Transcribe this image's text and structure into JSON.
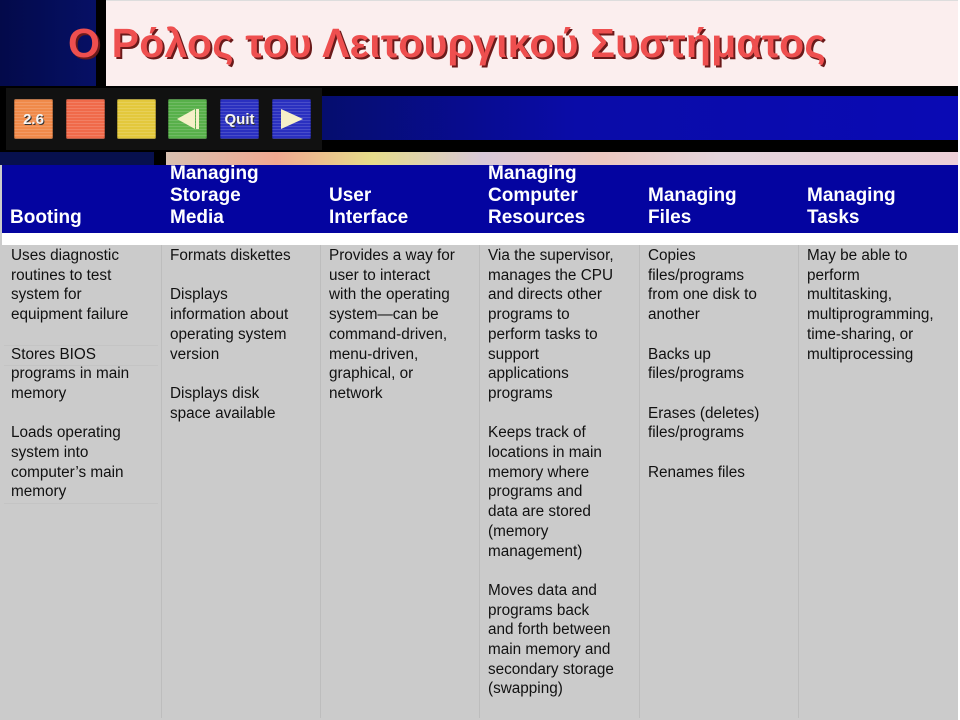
{
  "slide": {
    "title": "Ο Ρόλος του Λειτουργικού Συστήματος",
    "colors": {
      "title_text": "#ee4f4f",
      "title_background": "#fbeeee",
      "header_background": "#0404a0",
      "body_background": "#cbcbcb"
    }
  },
  "nav": {
    "section_label": "2.6",
    "prev_icon": "arrow-left-icon",
    "quit_label": "Quit",
    "next_icon": "arrow-right-icon"
  },
  "table": {
    "columns": [
      {
        "header": "Booting",
        "items": [
          "Uses diagnostic\nroutines to test\nsystem for\nequipment failure",
          "Stores BIOS\nprograms in main\nmemory",
          "Loads operating\nsystem into\ncomputer’s main\nmemory"
        ]
      },
      {
        "header": "Managing\nStorage\nMedia",
        "items": [
          "Formats diskettes",
          "Displays\ninformation about\noperating system\nversion",
          "Displays disk\nspace available"
        ]
      },
      {
        "header": "User\nInterface",
        "items": [
          "Provides a way for\nuser to interact\nwith the operating\nsystem—can be\ncommand-driven,\nmenu-driven,\ngraphical, or\nnetwork"
        ]
      },
      {
        "header": "Managing\nComputer\nResources",
        "items": [
          "Via the supervisor,\nmanages the CPU\nand directs other\nprograms to\nperform tasks to\nsupport\napplications\nprograms",
          "Keeps track of\nlocations in main\nmemory where\nprograms and\ndata are stored\n(memory\nmanagement)",
          "Moves data and\nprograms back\nand forth between\nmain memory and\nsecondary storage\n(swapping)"
        ]
      },
      {
        "header": "Managing\nFiles",
        "items": [
          "Copies\nfiles/programs\nfrom one disk to\nanother",
          "Backs up\nfiles/programs",
          "Erases (deletes)\nfiles/programs",
          "Renames files"
        ]
      },
      {
        "header": "Managing\nTasks",
        "items": [
          "May be able to\nperform\nmultitasking,\nmultiprogramming,\ntime-sharing, or\nmultiprocessing"
        ]
      }
    ]
  }
}
